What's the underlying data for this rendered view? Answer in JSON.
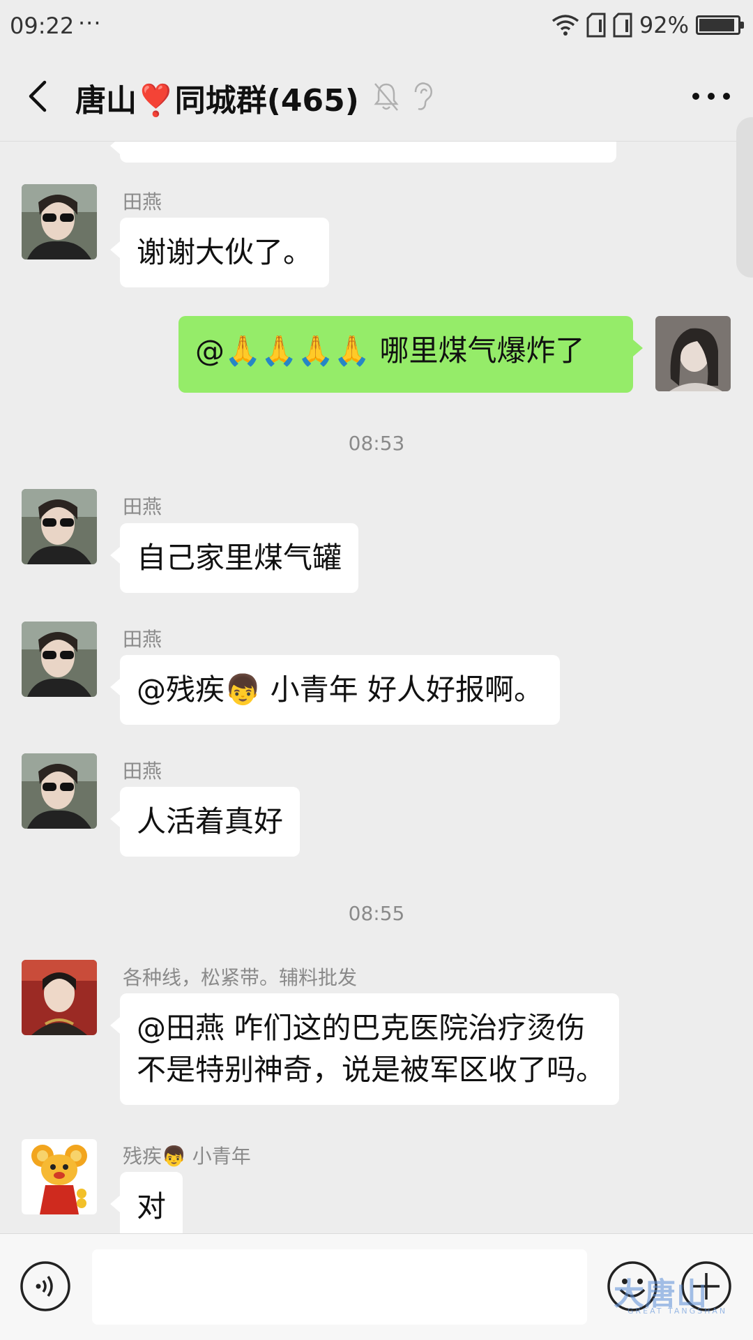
{
  "status_bar": {
    "time": "09:22",
    "dots": "···",
    "battery": "92%",
    "battery_level": 0.92
  },
  "header": {
    "title": "唐山❣️同城群(465)"
  },
  "messages": [
    {
      "sender": "田燕",
      "text": "谢谢大伙了。"
    },
    {
      "text": "@🙏🙏🙏🙏 哪里煤气爆炸了"
    },
    {
      "sender": "田燕",
      "text": "自己家里煤气罐"
    },
    {
      "sender": "田燕",
      "text": "@残疾👦 小青年  好人好报啊。"
    },
    {
      "sender": "田燕",
      "text": "人活着真好"
    },
    {
      "sender": "各种线，松紧带。辅料批发",
      "text_line1": "@田燕  咋们这的巴克医院治疗烫伤",
      "text_line2": "不是特别神奇，说是被军区收了吗。"
    },
    {
      "sender": "残疾👦 小青年",
      "text": "对"
    }
  ],
  "timestamps": [
    "08:53",
    "08:55"
  ],
  "watermark": {
    "text": "大唐山",
    "sub": "GREAT TANGSHAN"
  },
  "colors": {
    "background": "#ededed",
    "own_bubble": "#95ec69",
    "other_bubble": "#ffffff"
  }
}
